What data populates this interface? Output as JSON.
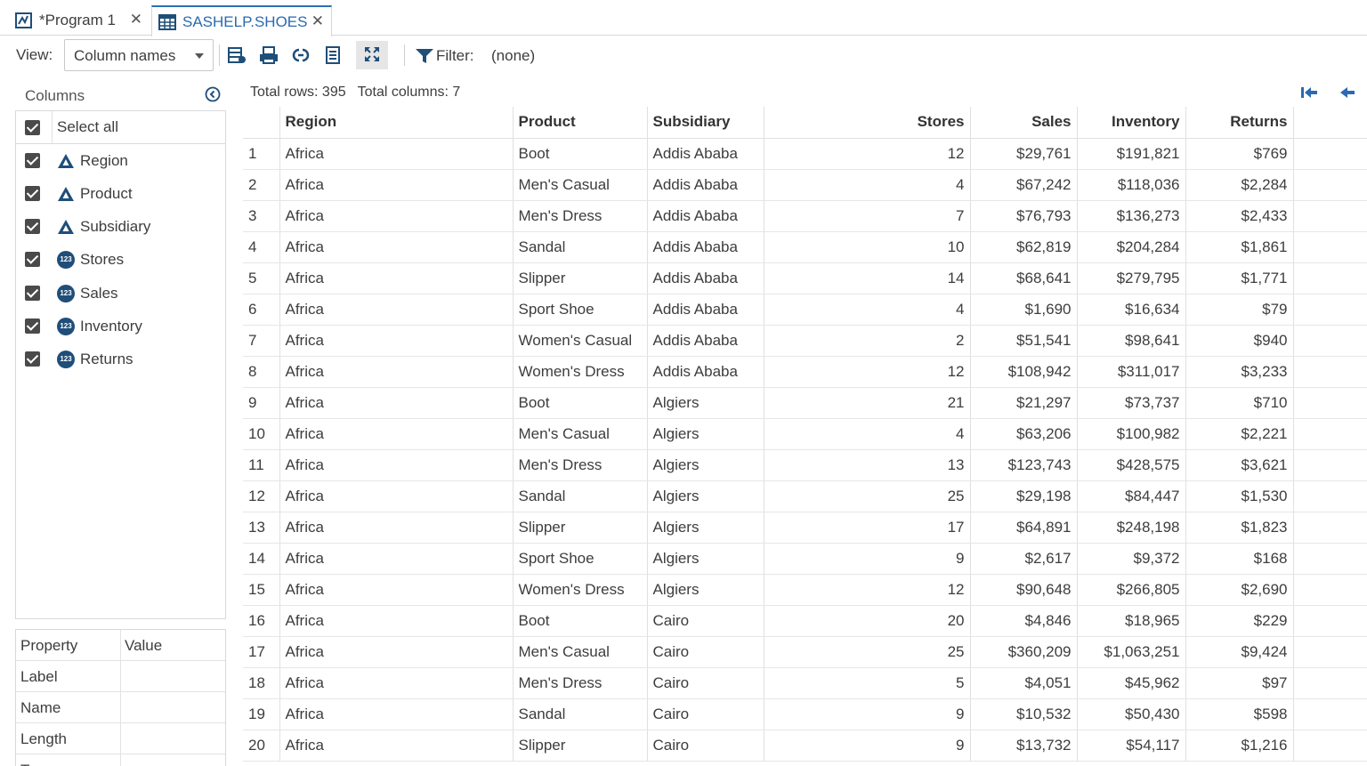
{
  "tabs": [
    {
      "label": "*Program 1",
      "icon": "program-icon"
    },
    {
      "label": "SASHELP.SHOES",
      "icon": "table-icon"
    }
  ],
  "toolbar": {
    "view_label": "View:",
    "view_value": "Column names",
    "filter_label": "Filter:",
    "filter_value": "(none)",
    "icons": [
      "refresh-table-icon",
      "print-icon",
      "link-icon",
      "column-list-icon",
      "maximize-icon"
    ]
  },
  "columns_panel": {
    "title": "Columns",
    "select_all": "Select all",
    "items": [
      {
        "label": "Region",
        "type": "char"
      },
      {
        "label": "Product",
        "type": "char"
      },
      {
        "label": "Subsidiary",
        "type": "char"
      },
      {
        "label": "Stores",
        "type": "num"
      },
      {
        "label": "Sales",
        "type": "num"
      },
      {
        "label": "Inventory",
        "type": "num"
      },
      {
        "label": "Returns",
        "type": "num"
      }
    ],
    "num_badge": "123"
  },
  "properties": {
    "headers": [
      "Property",
      "Value"
    ],
    "rows": [
      "Label",
      "Name",
      "Length",
      "T"
    ]
  },
  "grid": {
    "summary": "Total rows: 395   Total columns: 7",
    "headers": [
      "",
      "Region",
      "Product",
      "Subsidiary",
      "Stores",
      "Sales",
      "Inventory",
      "Returns"
    ],
    "rows": [
      [
        "1",
        "Africa",
        "Boot",
        "Addis Ababa",
        "12",
        "$29,761",
        "$191,821",
        "$769"
      ],
      [
        "2",
        "Africa",
        "Men's Casual",
        "Addis Ababa",
        "4",
        "$67,242",
        "$118,036",
        "$2,284"
      ],
      [
        "3",
        "Africa",
        "Men's Dress",
        "Addis Ababa",
        "7",
        "$76,793",
        "$136,273",
        "$2,433"
      ],
      [
        "4",
        "Africa",
        "Sandal",
        "Addis Ababa",
        "10",
        "$62,819",
        "$204,284",
        "$1,861"
      ],
      [
        "5",
        "Africa",
        "Slipper",
        "Addis Ababa",
        "14",
        "$68,641",
        "$279,795",
        "$1,771"
      ],
      [
        "6",
        "Africa",
        "Sport Shoe",
        "Addis Ababa",
        "4",
        "$1,690",
        "$16,634",
        "$79"
      ],
      [
        "7",
        "Africa",
        "Women's Casual",
        "Addis Ababa",
        "2",
        "$51,541",
        "$98,641",
        "$940"
      ],
      [
        "8",
        "Africa",
        "Women's Dress",
        "Addis Ababa",
        "12",
        "$108,942",
        "$311,017",
        "$3,233"
      ],
      [
        "9",
        "Africa",
        "Boot",
        "Algiers",
        "21",
        "$21,297",
        "$73,737",
        "$710"
      ],
      [
        "10",
        "Africa",
        "Men's Casual",
        "Algiers",
        "4",
        "$63,206",
        "$100,982",
        "$2,221"
      ],
      [
        "11",
        "Africa",
        "Men's Dress",
        "Algiers",
        "13",
        "$123,743",
        "$428,575",
        "$3,621"
      ],
      [
        "12",
        "Africa",
        "Sandal",
        "Algiers",
        "25",
        "$29,198",
        "$84,447",
        "$1,530"
      ],
      [
        "13",
        "Africa",
        "Slipper",
        "Algiers",
        "17",
        "$64,891",
        "$248,198",
        "$1,823"
      ],
      [
        "14",
        "Africa",
        "Sport Shoe",
        "Algiers",
        "9",
        "$2,617",
        "$9,372",
        "$168"
      ],
      [
        "15",
        "Africa",
        "Women's Dress",
        "Algiers",
        "12",
        "$90,648",
        "$266,805",
        "$2,690"
      ],
      [
        "16",
        "Africa",
        "Boot",
        "Cairo",
        "20",
        "$4,846",
        "$18,965",
        "$229"
      ],
      [
        "17",
        "Africa",
        "Men's Casual",
        "Cairo",
        "25",
        "$360,209",
        "$1,063,251",
        "$9,424"
      ],
      [
        "18",
        "Africa",
        "Men's Dress",
        "Cairo",
        "5",
        "$4,051",
        "$45,962",
        "$97"
      ],
      [
        "19",
        "Africa",
        "Sandal",
        "Cairo",
        "9",
        "$10,532",
        "$50,430",
        "$598"
      ],
      [
        "20",
        "Africa",
        "Slipper",
        "Cairo",
        "9",
        "$13,732",
        "$54,117",
        "$1,216"
      ]
    ]
  },
  "colors": {
    "accent": "#2a6ab0",
    "icon_dark": "#1f4e79",
    "border": "#d9d9d9"
  }
}
